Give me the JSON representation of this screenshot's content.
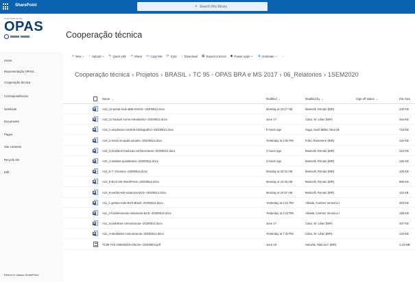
{
  "topbar": {
    "brand": "SharePoint",
    "search_placeholder": "Search this library",
    "search_icon": "search-icon",
    "app_launcher_icon": "waffle-icon"
  },
  "logo": {
    "caption_line1": "Cooperação técnica",
    "caption_line2": "",
    "acronym": "OPAS"
  },
  "site_title": "Cooperação técnica",
  "leftnav": {
    "items": [
      "Home",
      "Representação OPAS/...",
      "Cooperação técnica",
      "Correspondências",
      "Notebook",
      "Documents",
      "Pages",
      "Site contents",
      "Recycle bin",
      "Edit"
    ],
    "return_link": "Return to classic SharePoint"
  },
  "commands": [
    {
      "label": "New",
      "icon": "plus-icon",
      "chevron": "⌄"
    },
    {
      "label": "Upload",
      "icon": "upload-icon",
      "chevron": "⌄"
    },
    {
      "label": "Quick edit",
      "icon": "edit-icon"
    },
    {
      "label": "Share",
      "icon": "share-icon"
    },
    {
      "label": "Copy link",
      "icon": "link-icon"
    },
    {
      "label": "Sync",
      "icon": "sync-icon"
    },
    {
      "label": "Download",
      "icon": "download-icon"
    },
    {
      "label": "Export to Excel",
      "icon": "excel-icon"
    },
    {
      "label": "Power Apps",
      "icon": "powerapps-icon",
      "chevron": "⌄"
    },
    {
      "label": "Automate",
      "icon": "flow-icon",
      "chevron": "⌄"
    },
    {
      "label": "···",
      "icon": ""
    }
  ],
  "breadcrumb": [
    "Cooperação técnica",
    "Projetos",
    "BRASIL",
    "TC 95 - OPAS BRA e MS 2017",
    "06_Relatorios",
    "1SEM2020"
  ],
  "columns": {
    "name": "Name",
    "modified": "Modified",
    "modified_by": "Modified by",
    "signoff": "Sign-off status",
    "size": "File Size"
  },
  "files": [
    {
      "type": "word",
      "name": "A10_10-portal-rede-BIBLIOSUS--20200612.docx",
      "modified": "Monday at 10:27 AM",
      "by": "Marinelli, Renato (BIR)",
      "size": "230 KB"
    },
    {
      "type": "word",
      "name": "A10_11-traduzir-curso-introdutório--20200612.docx",
      "modified": "June 17",
      "by": "Cabo, Dr. Lilian (BIR)",
      "size": "254 KB"
    },
    {
      "type": "word",
      "name": "A10_1-ampliacao-controle-bibliografico--20200612.docx",
      "modified": "5 hours ago",
      "by": "Suga, Sueli Mitiko Yano (B",
      "size": "743 KB"
    },
    {
      "type": "word",
      "name": "A10_2-servicos-ajuda-usuario--20200612.docx",
      "modified": "Yesterday at 2:00 PM",
      "by": "Fobo, Rosemere (BIR)",
      "size": "120 KB"
    },
    {
      "type": "word",
      "name": "A10_3-produtos-traducao-conhecimento--20200612.docx",
      "modified": "4 hours ago",
      "by": "Marinelli, Renato (BIR)",
      "size": "124 KB"
    },
    {
      "type": "word",
      "name": "A10_4-analisis-quantitativo--20200612.docx",
      "modified": "3 hours ago",
      "by": "Marinelli, Renato (BIR)",
      "size": "126 KB"
    },
    {
      "type": "word",
      "name": "A10_6-7--Gnoteca--20200612.docx",
      "modified": "Monday at 10:31 AM",
      "by": "Marinelli, Renato (BIR)",
      "size": "105 KB"
    },
    {
      "type": "word",
      "name": "A10_8-BVS-MS-WordPress--20200612.docx",
      "modified": "Monday at 10:45 AM",
      "by": "Marinelli, Renato (BIR)",
      "size": "886 KB"
    },
    {
      "type": "word",
      "name": "A10_9-portal-rede-estacoes-BVS--20200612.docx",
      "modified": "Monday at 10:57 AM",
      "by": "Marinelli, Renato (BIR)",
      "size": "118 KB"
    },
    {
      "type": "word",
      "name": "A11_1-gestao-rede-BVS-Brasil--20200612.docx",
      "modified": "Yesterday at 2:21 PM",
      "by": "Abdala, Carmen Veronica I",
      "size": "263 KB"
    },
    {
      "type": "word",
      "name": "A11_2-fortalecimento-instancias-BVS--20200612.docx",
      "modified": "Yesterday at 2:23 PM",
      "by": "Abdala, Carmen Veronica I",
      "size": "198 KB"
    },
    {
      "type": "word",
      "name": "A11_3-palestras-comunicacao--20200612.docx",
      "modified": "June 17",
      "by": "Cabo, Dr. Lilian (BIR)",
      "size": "257 KB"
    },
    {
      "type": "word",
      "name": "A11_4-atividades-comunicacao--20200612.docx",
      "modified": "Yesterday at 7:33 PM",
      "by": "Cabo, Dr. Lilian (BIR)",
      "size": "134 KB"
    },
    {
      "type": "pdf",
      "name": "TC95-TA6-2SEM2019-informe--20200604.pdf",
      "modified": "June 18",
      "by": "Sanvitto, Marcia F. (BIR)",
      "size": "1.22 MB"
    }
  ],
  "colors": {
    "suite_bar": "#0b62b0",
    "accent": "#0078d4",
    "word_blue": "#2b579a"
  }
}
